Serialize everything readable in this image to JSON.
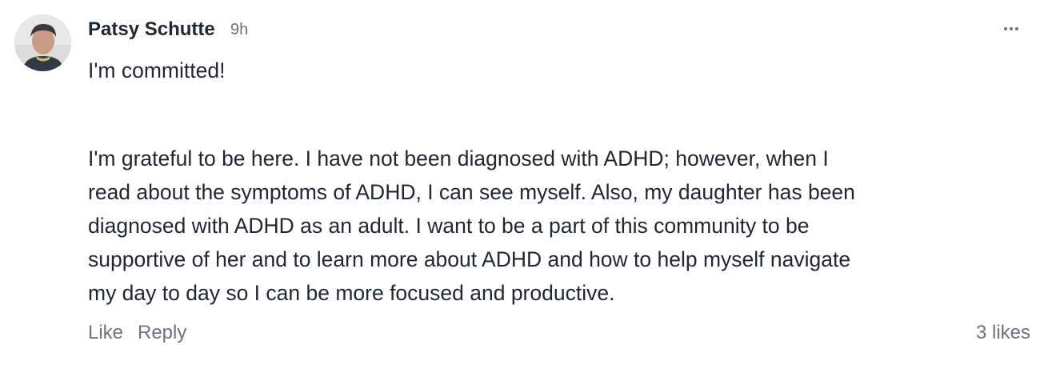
{
  "comment": {
    "author": "Patsy Schutte",
    "timestamp": "9h",
    "avatar_icon": "user-avatar-photo",
    "more_icon": "more-horizontal-icon",
    "paragraph_1": "I'm committed!",
    "paragraph_2": "I'm grateful to be here. I have not been diagnosed with ADHD; however, when I\nread about the symptoms of ADHD, I can see myself. Also, my daughter has been\ndiagnosed with ADHD as an adult. I want to be a part of this community to be\nsupportive of her and to learn more about ADHD and how to help myself navigate\nmy day to day so I can be more focused and productive.",
    "like_label": "Like",
    "reply_label": "Reply",
    "likes_count": "3 likes"
  },
  "colors": {
    "text": "#1f2733",
    "muted": "#6b7280",
    "background": "#ffffff"
  }
}
